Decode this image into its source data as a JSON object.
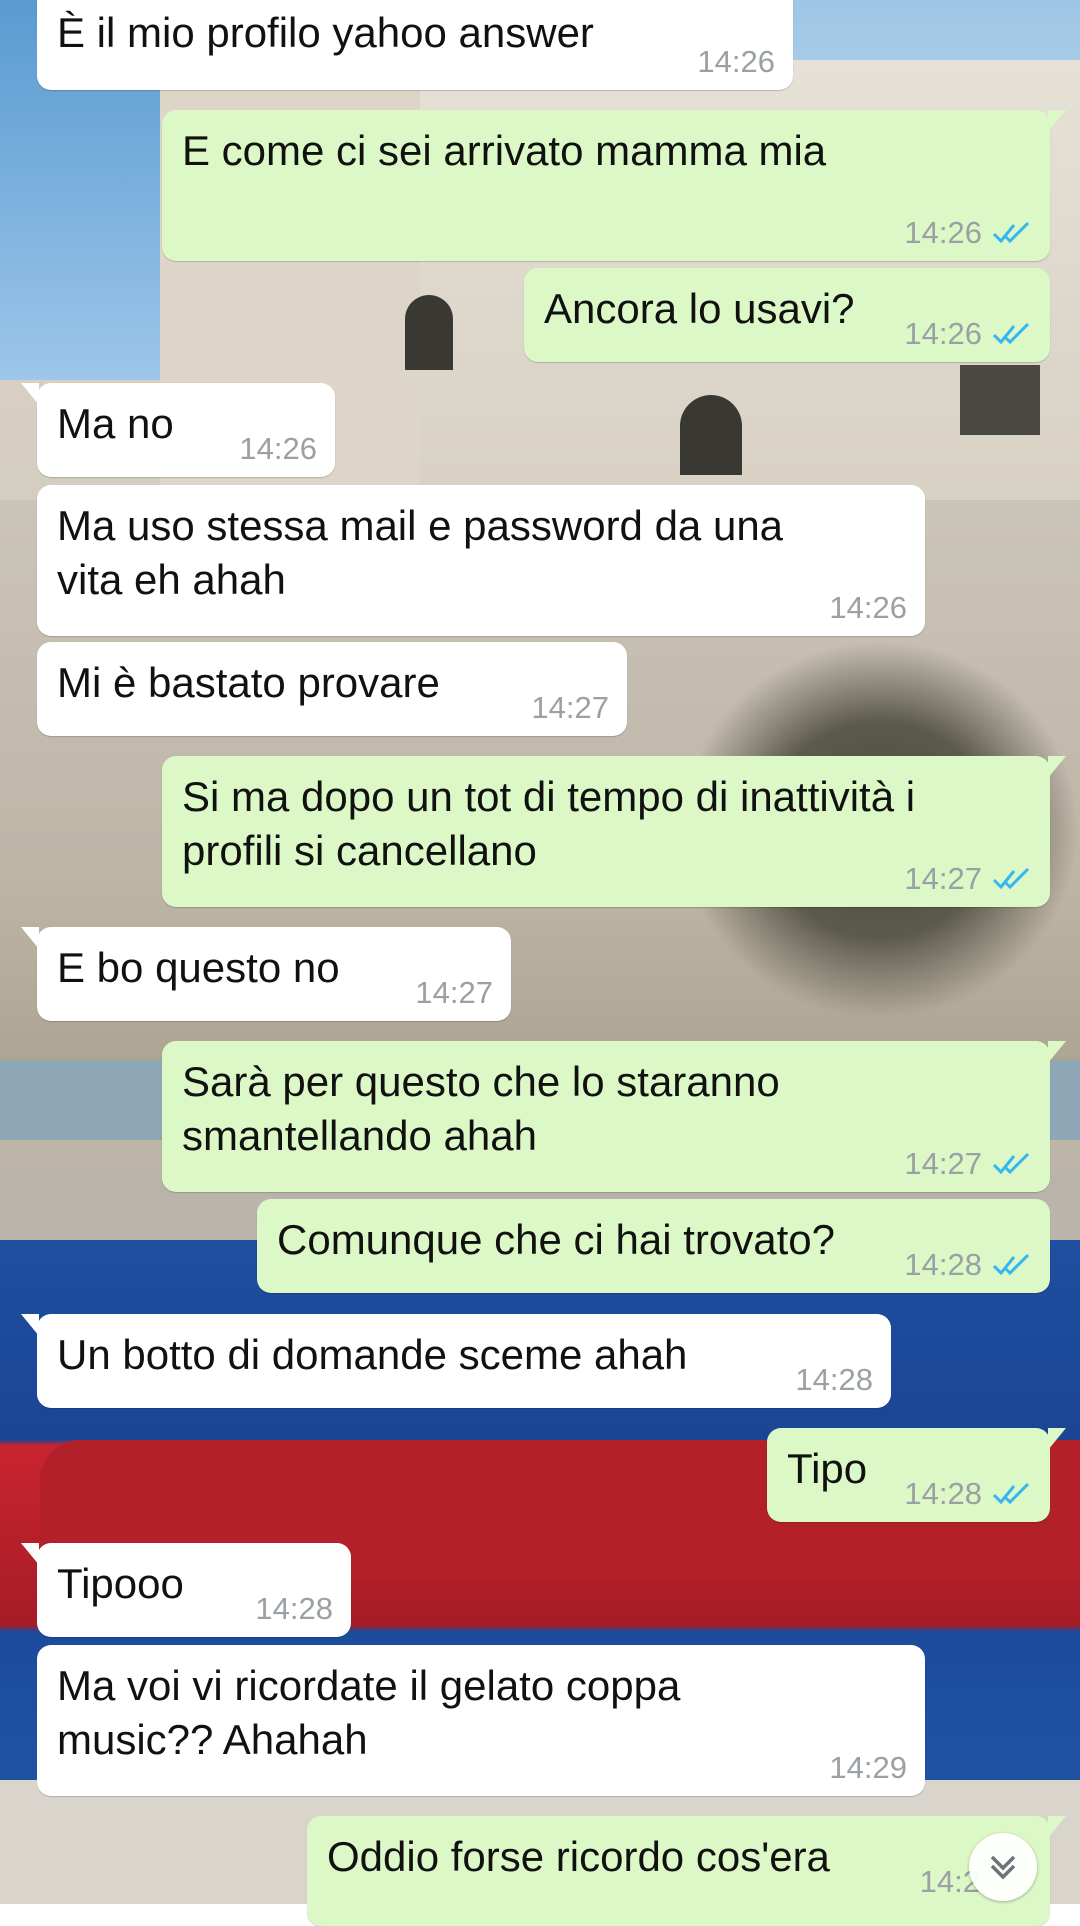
{
  "chat": {
    "messages": [
      {
        "dir": "in",
        "text": [
          "È il mio profilo yahoo answer"
        ],
        "time": "14:26"
      },
      {
        "dir": "out",
        "text": [
          "E come ci sei arrivato mamma mia"
        ],
        "time": "14:26",
        "read": true
      },
      {
        "dir": "out",
        "text": [
          "Ancora lo usavi?"
        ],
        "time": "14:26",
        "read": true
      },
      {
        "dir": "in",
        "text": [
          "Ma no"
        ],
        "time": "14:26"
      },
      {
        "dir": "in",
        "text": [
          "Ma uso stessa mail e password da una",
          "vita eh ahah"
        ],
        "time": "14:26"
      },
      {
        "dir": "in",
        "text": [
          "Mi è bastato provare"
        ],
        "time": "14:27"
      },
      {
        "dir": "out",
        "text": [
          "Si ma dopo un tot di tempo di inattività i",
          "profili si cancellano"
        ],
        "time": "14:27",
        "read": true
      },
      {
        "dir": "in",
        "text": [
          "E bo questo no"
        ],
        "time": "14:27"
      },
      {
        "dir": "out",
        "text": [
          "Sarà per questo che lo staranno",
          "smantellando ahah"
        ],
        "time": "14:27",
        "read": true
      },
      {
        "dir": "out",
        "text": [
          "Comunque che ci hai trovato?"
        ],
        "time": "14:28",
        "read": true
      },
      {
        "dir": "in",
        "text": [
          "Un botto di domande sceme ahah"
        ],
        "time": "14:28"
      },
      {
        "dir": "out",
        "text": [
          "Tipo"
        ],
        "time": "14:28",
        "read": true
      },
      {
        "dir": "in",
        "text": [
          "Tipooo"
        ],
        "time": "14:28"
      },
      {
        "dir": "in",
        "text": [
          "Ma voi vi ricordate il gelato coppa",
          "music?? Ahahah"
        ],
        "time": "14:29"
      },
      {
        "dir": "out",
        "text": [
          "Oddio forse ricordo cos'era"
        ],
        "time": "14:2",
        "read": true
      }
    ]
  },
  "colors": {
    "incoming_bubble": "#ffffff",
    "outgoing_bubble": "#dcf8c6",
    "read_tick": "#34b7f1",
    "timestamp": "#9aa0a3"
  },
  "icons": {
    "read_receipt": "double-check-icon",
    "scroll_down": "chevron-double-down-icon"
  }
}
